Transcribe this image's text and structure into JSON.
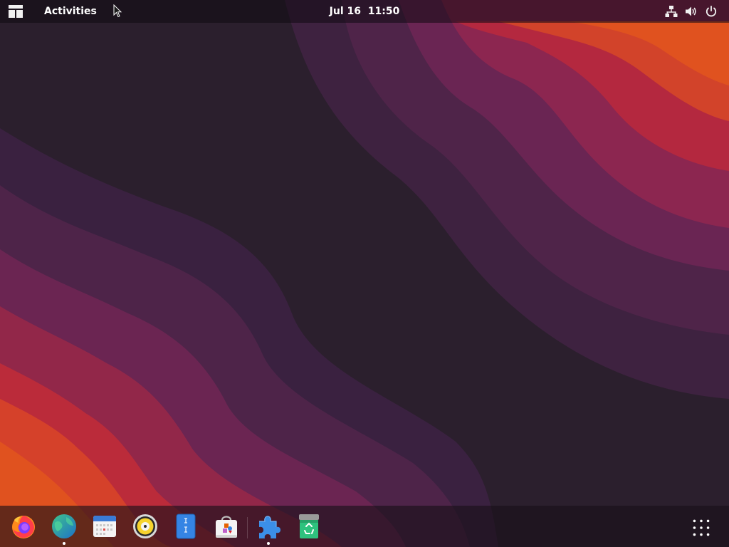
{
  "topbar": {
    "activities_label": "Activities",
    "clock_date": "Jul 16",
    "clock_time": "11:50",
    "tray": {
      "network_icon": "network-wired-icon",
      "volume_icon": "volume-icon",
      "power_icon": "power-icon"
    }
  },
  "dock": {
    "items": [
      {
        "icon": "firefox-icon",
        "running": false
      },
      {
        "icon": "globe-browser-icon",
        "running": true
      },
      {
        "icon": "calendar-icon",
        "running": false
      },
      {
        "icon": "rhythmbox-speaker-icon",
        "running": false
      },
      {
        "icon": "document-viewer-icon",
        "running": false
      },
      {
        "icon": "software-store-icon",
        "running": false
      },
      {
        "icon": "extensions-puzzle-icon",
        "running": true
      },
      {
        "icon": "trash-icon",
        "running": false
      }
    ],
    "show_apps_icon": "show-apps-grid-icon"
  },
  "colors": {
    "wallpaper_dark": "#2b1f2d",
    "wallpaper_purple": "#5a2450",
    "wallpaper_red": "#b0284a",
    "wallpaper_orange": "#e0521f"
  }
}
